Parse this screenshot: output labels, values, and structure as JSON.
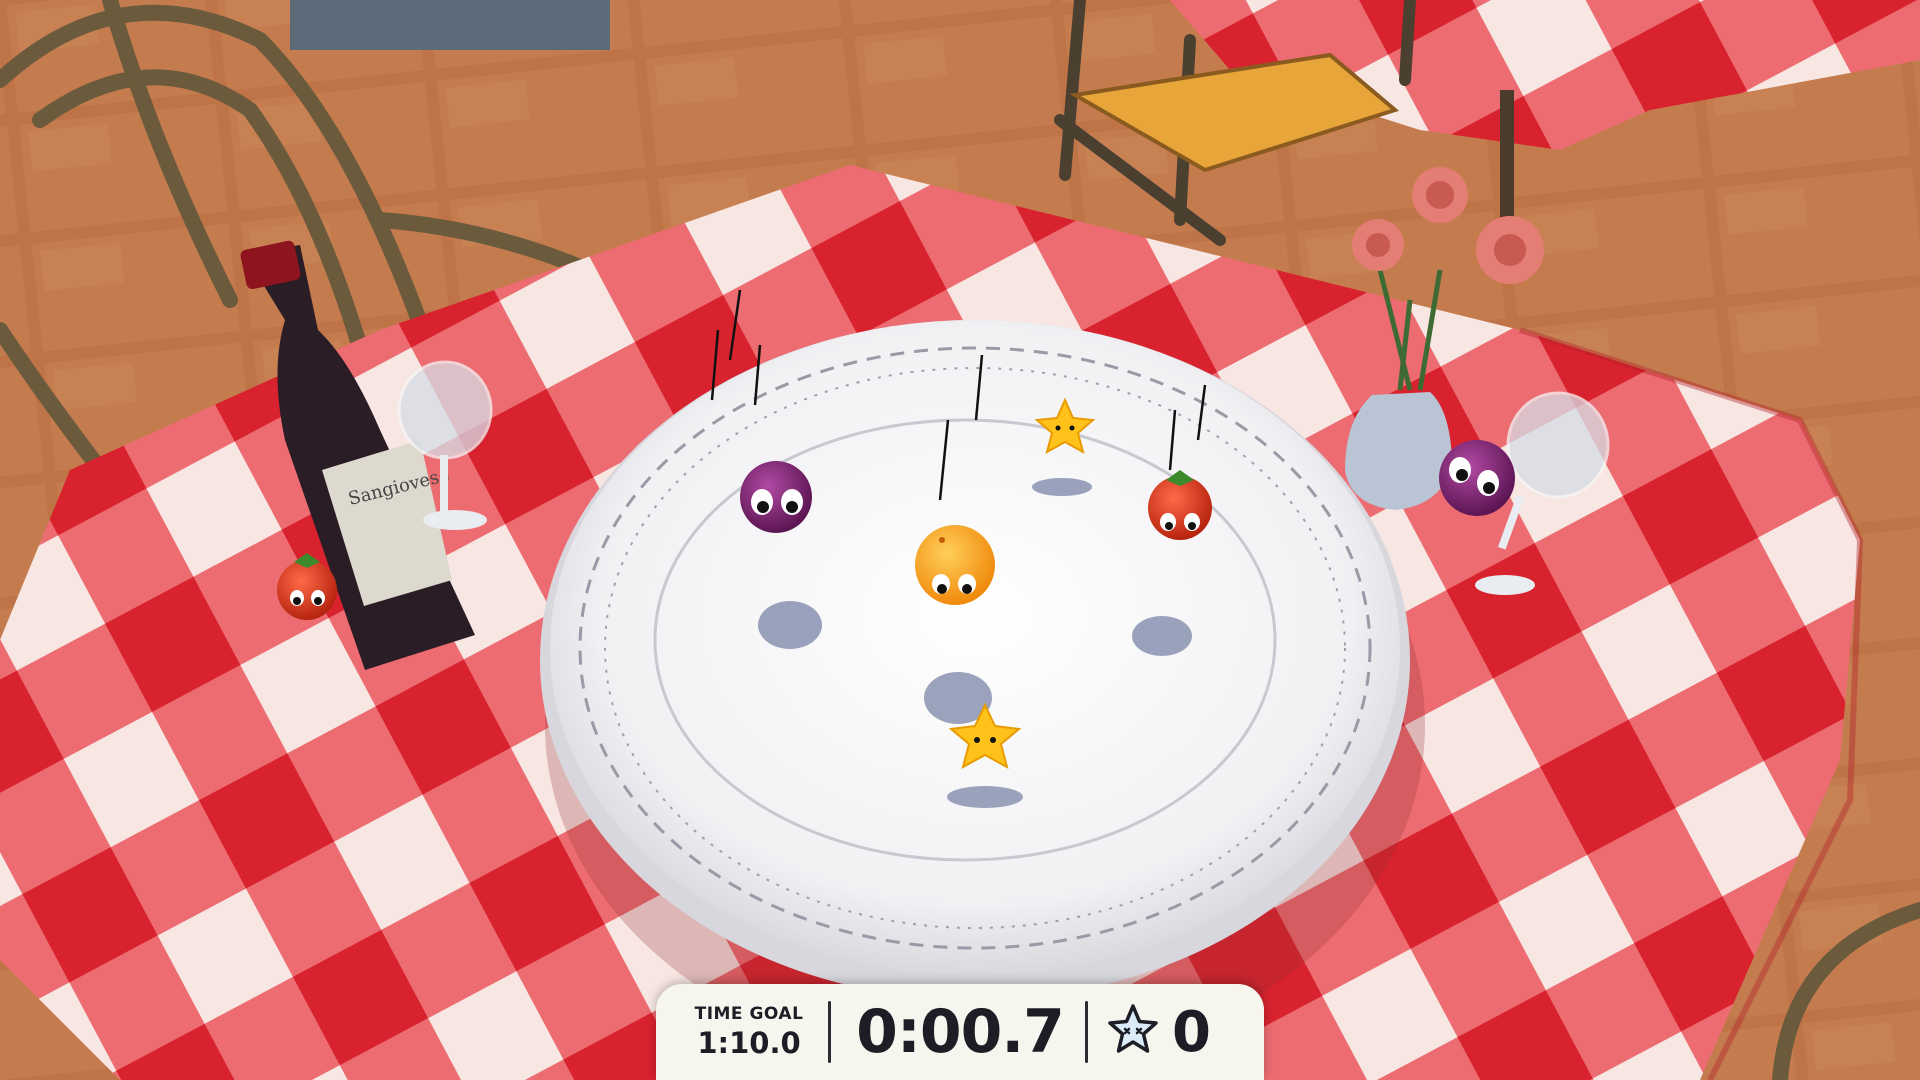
{
  "hud": {
    "time_goal_label": "TIME GOAL",
    "time_goal_value": "1:10.0",
    "elapsed_time": "0:00.7",
    "star_count": "0"
  },
  "scene": {
    "bottle_label": "Sangiovese",
    "characters": [
      {
        "name": "onion-character",
        "color": "#7a1f6e"
      },
      {
        "name": "orange-character",
        "color": "#f59a12"
      },
      {
        "name": "tomato-character",
        "color": "#d9391c"
      },
      {
        "name": "star-pickup",
        "color": "#ffc21a"
      }
    ]
  },
  "colors": {
    "tablecloth_red": "#e0333c",
    "tablecloth_white": "#fbf3ee",
    "floor_tile": "#c0774a",
    "grout": "#e6e0d6",
    "plate": "#f3f3f6"
  }
}
